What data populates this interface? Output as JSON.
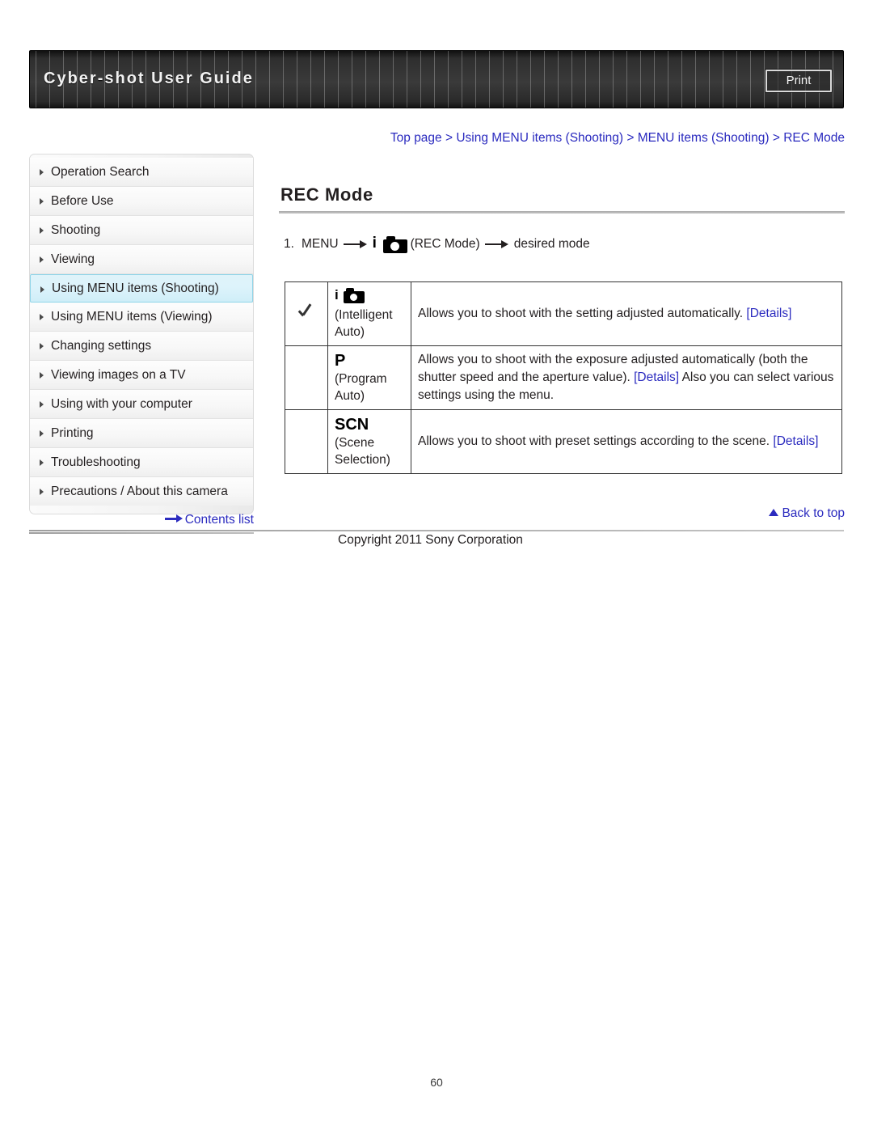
{
  "header": {
    "title": "Cyber-shot User Guide",
    "print_label": "Print"
  },
  "breadcrumb": {
    "text": "Top page > Using MENU items (Shooting) > MENU items (Shooting) > REC Mode"
  },
  "sidebar": {
    "items": [
      {
        "label": "Operation Search",
        "active": false
      },
      {
        "label": "Before Use",
        "active": false
      },
      {
        "label": "Shooting",
        "active": false
      },
      {
        "label": "Viewing",
        "active": false
      },
      {
        "label": "Using MENU items (Shooting)",
        "active": true
      },
      {
        "label": "Using MENU items (Viewing)",
        "active": false
      },
      {
        "label": "Changing settings",
        "active": false
      },
      {
        "label": "Viewing images on a TV",
        "active": false
      },
      {
        "label": "Using with your computer",
        "active": false
      },
      {
        "label": "Printing",
        "active": false
      },
      {
        "label": "Troubleshooting",
        "active": false
      },
      {
        "label": "Precautions / About this camera",
        "active": false
      }
    ],
    "contents_list_label": "Contents list"
  },
  "main": {
    "page_title": "REC Mode",
    "step": {
      "number": "1.",
      "menu_label": "MENU",
      "icon_name": "intelligent-auto-camera-icon",
      "mode_label": "(REC Mode)",
      "tail_label": "desired mode"
    },
    "table": {
      "rows": [
        {
          "checked": true,
          "glyph": "iA-camera-icon",
          "glyph_text": "",
          "mode_name": "(Intelligent",
          "mode_name2": "Auto)",
          "desc_before": "Allows you to shoot with the setting adjusted automatically. ",
          "link1": "[Details]",
          "desc_middle": "",
          "link2": "",
          "desc_after": ""
        },
        {
          "checked": false,
          "glyph": "P",
          "glyph_text": "P",
          "mode_name": "(Program",
          "mode_name2": "Auto)",
          "desc_before": "Allows you to shoot with the exposure adjusted automatically (both the shutter speed and the aperture value). ",
          "link1": "[Details]",
          "desc_middle": " Also you can select various settings using the menu.",
          "link2": "",
          "desc_after": ""
        },
        {
          "checked": false,
          "glyph": "SCN",
          "glyph_text": "SCN",
          "mode_name": "(Scene",
          "mode_name2": "Selection)",
          "desc_before": "Allows you to shoot with preset settings according to the scene. ",
          "link1": "[Details]",
          "desc_middle": "",
          "link2": "",
          "desc_after": ""
        }
      ]
    }
  },
  "footer": {
    "back_to_top_label": "Back to top",
    "copyright": "Copyright 2011 Sony Corporation",
    "page_number": "60"
  },
  "colors": {
    "link": "#2b2bbf",
    "text": "#231f20",
    "active_sidebar_bg": "#ddf3fb",
    "active_sidebar_border": "#8fd4e8",
    "header_bg": "#2e2e2e"
  }
}
